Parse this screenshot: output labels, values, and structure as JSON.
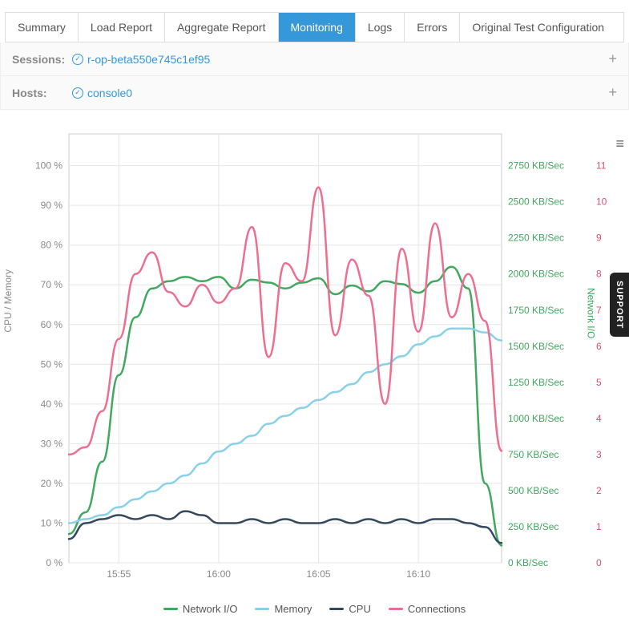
{
  "tabs": [
    "Summary",
    "Load Report",
    "Aggregate Report",
    "Monitoring",
    "Logs",
    "Errors",
    "Original Test Configuration"
  ],
  "active_tab": "Monitoring",
  "sessions": {
    "label": "Sessions:",
    "value": "r-op-beta550e745c1ef95"
  },
  "hosts": {
    "label": "Hosts:",
    "value": "console0"
  },
  "support_label": "SUPPORT",
  "axis_left_title": "CPU / Memory",
  "axis_right_title": "Network I/O",
  "chart_data": {
    "type": "line",
    "xlabel": "",
    "x_ticks": [
      "15:55",
      "16:00",
      "16:05",
      "16:10"
    ],
    "left_axis": {
      "label": "CPU / Memory",
      "ticks": [
        "0 %",
        "10 %",
        "20 %",
        "30 %",
        "40 %",
        "50 %",
        "60 %",
        "70 %",
        "80 %",
        "90 %",
        "100 %"
      ],
      "range": [
        0,
        108
      ]
    },
    "right_axis_1": {
      "label": "Network I/O",
      "ticks": [
        "0 KB/Sec",
        "250 KB/Sec",
        "500 KB/Sec",
        "750 KB/Sec",
        "1000 KB/Sec",
        "1250 KB/Sec",
        "1500 KB/Sec",
        "1750 KB/Sec",
        "2000 KB/Sec",
        "2250 KB/Sec",
        "2500 KB/Sec",
        "2750 KB/Sec"
      ],
      "range": [
        0,
        2970
      ]
    },
    "right_axis_2": {
      "label": "Connections",
      "ticks": [
        "0",
        "1",
        "2",
        "3",
        "4",
        "5",
        "6",
        "7",
        "8",
        "9",
        "10",
        "11"
      ],
      "range": [
        0,
        11.88
      ]
    },
    "series": [
      {
        "name": "Network I/O",
        "color": "#41a85f",
        "axis": "right1",
        "values": [
          200,
          350,
          700,
          1300,
          1700,
          1900,
          1950,
          1980,
          1950,
          1980,
          1900,
          1960,
          1940,
          1900,
          1940,
          1970,
          1860,
          1920,
          1880,
          1950,
          1930,
          1870,
          1950,
          2050,
          1900,
          550,
          120
        ]
      },
      {
        "name": "Memory",
        "color": "#89d1e8",
        "axis": "left",
        "values": [
          10,
          11,
          12,
          14,
          16,
          18,
          20,
          22,
          25,
          28,
          30,
          32,
          35,
          37,
          39,
          41,
          43,
          45,
          48,
          50,
          52,
          55,
          57,
          59,
          59,
          58,
          56
        ]
      },
      {
        "name": "CPU",
        "color": "#34495e",
        "axis": "left",
        "values": [
          6,
          10,
          11,
          12,
          11,
          12,
          11,
          13,
          12,
          10,
          10,
          11,
          10,
          11,
          10,
          10,
          11,
          10,
          11,
          10,
          11,
          10,
          11,
          11,
          10,
          9,
          5
        ]
      },
      {
        "name": "Connections",
        "color": "#ee6e91",
        "axis": "right2",
        "values": [
          3.0,
          3.2,
          4.2,
          6.2,
          8.0,
          8.6,
          7.5,
          7.1,
          7.7,
          7.2,
          7.6,
          9.3,
          5.7,
          8.3,
          7.8,
          10.4,
          6.3,
          8.4,
          7.4,
          4.4,
          8.7,
          6.4,
          9.4,
          6.8,
          8.0,
          6.7,
          3.1
        ]
      }
    ],
    "legend": [
      "Network I/O",
      "Memory",
      "CPU",
      "Connections"
    ]
  }
}
